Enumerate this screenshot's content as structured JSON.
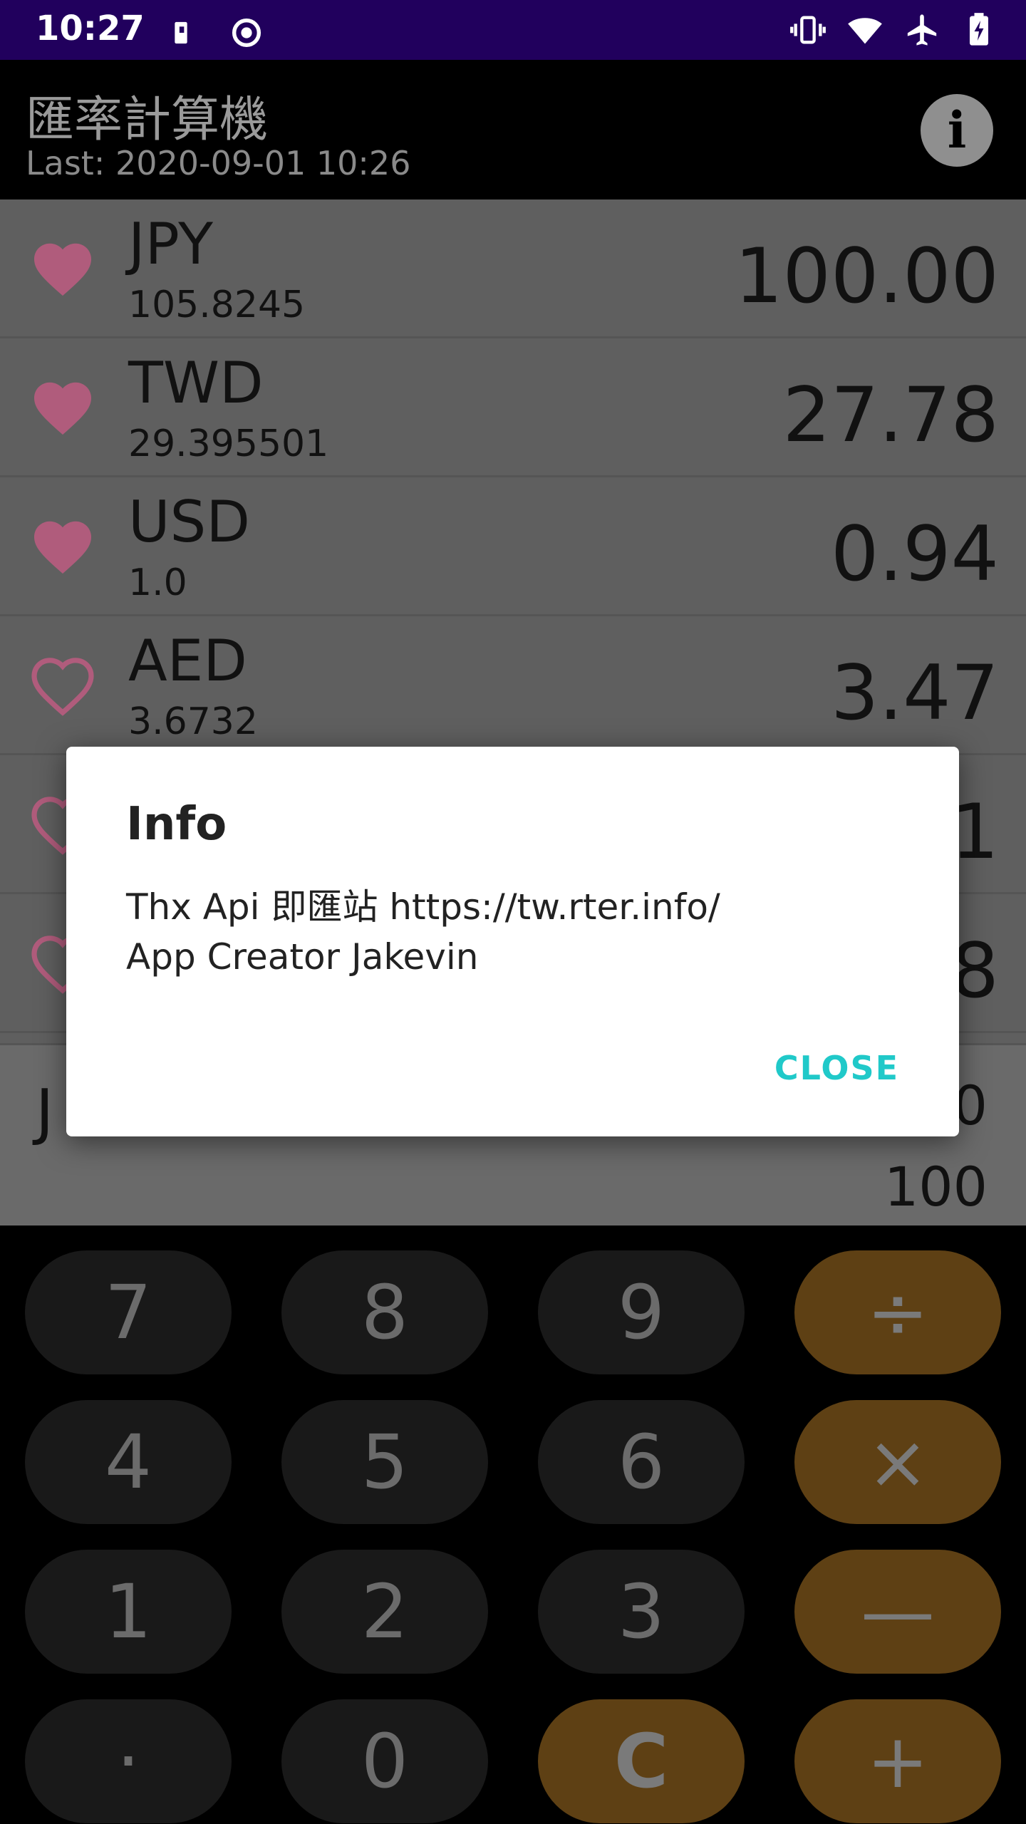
{
  "status_bar": {
    "time": "10:27",
    "icons": [
      "sim-icon",
      "record-icon",
      "vibrate-icon",
      "wifi-icon",
      "airplane-icon",
      "battery-icon"
    ]
  },
  "app_bar": {
    "title": "匯率計算機",
    "subtitle": "Last: 2020-09-01 10:26",
    "info_label": "i"
  },
  "currencies": [
    {
      "code": "JPY",
      "rate": "105.8245",
      "amount": "100.00",
      "favorite": true
    },
    {
      "code": "TWD",
      "rate": "29.395501",
      "amount": "27.78",
      "favorite": true
    },
    {
      "code": "USD",
      "rate": "1.0",
      "amount": "0.94",
      "favorite": true
    },
    {
      "code": "AED",
      "rate": "3.6732",
      "amount": "3.47",
      "favorite": false
    },
    {
      "code": "",
      "rate": "",
      "amount": "1",
      "favorite": false
    },
    {
      "code": "",
      "rate": "",
      "amount": "8",
      "favorite": false
    }
  ],
  "display": {
    "currency_letter": "J",
    "top_value": "0",
    "bottom_value": "100"
  },
  "keypad": {
    "keys": [
      "7",
      "8",
      "9",
      "÷",
      "4",
      "5",
      "6",
      "×",
      "1",
      "2",
      "3",
      "—",
      "·",
      "0",
      "C",
      "+"
    ]
  },
  "dialog": {
    "title": "Info",
    "line1": "Thx Api 即匯站 https://tw.rter.info/",
    "line2": "App Creator Jakevin",
    "close_label": "CLOSE"
  },
  "colors": {
    "status_bar": "#21005d",
    "heart": "#b05c7c",
    "operator_key": "#5e4014",
    "dialog_accent": "#20c9c9"
  }
}
